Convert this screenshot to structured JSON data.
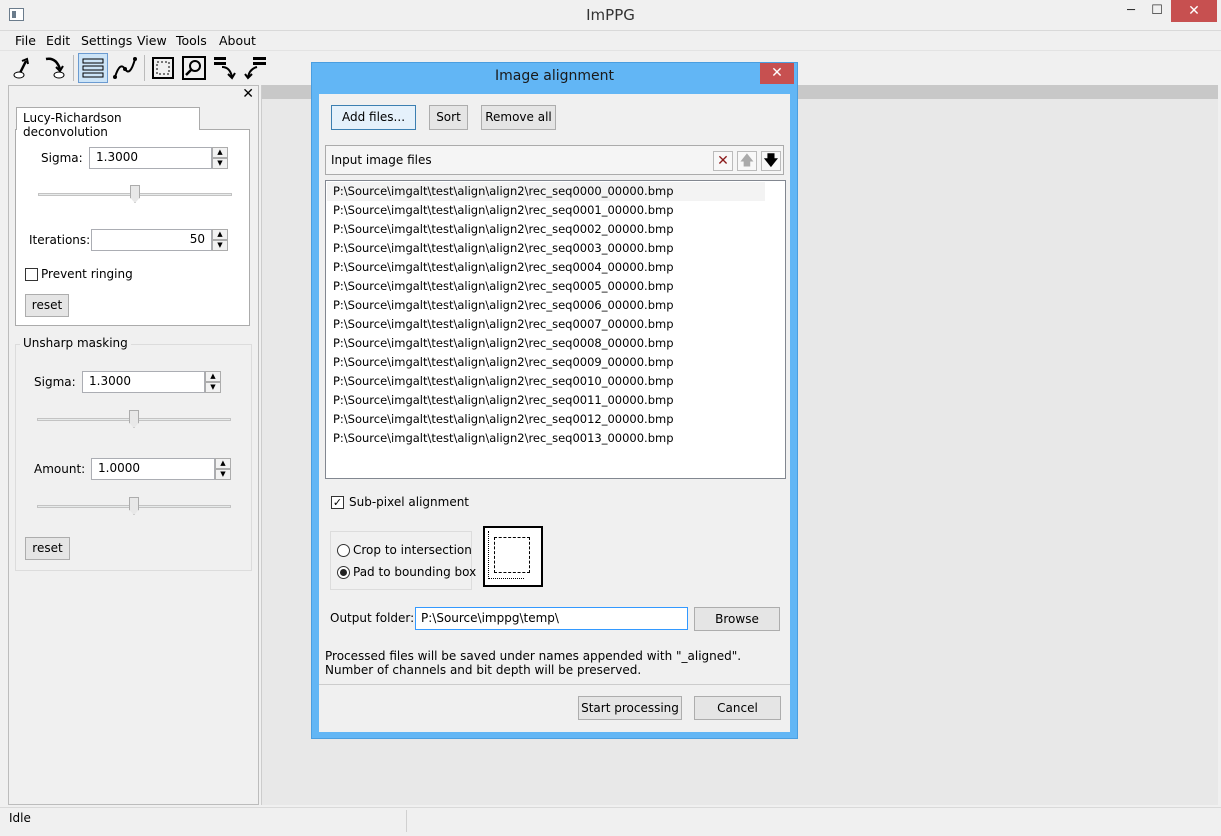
{
  "window": {
    "title": "ImPPG",
    "minimize": "─",
    "maximize": "☐",
    "close": "✕"
  },
  "menu": [
    "File",
    "Edit",
    "Settings",
    "View",
    "Tools",
    "About"
  ],
  "left_panel": {
    "close": "✕",
    "lr_tab": "Lucy-Richardson deconvolution",
    "lr": {
      "sigma_label": "Sigma:",
      "sigma_value": "1.3000",
      "iterations_label": "Iterations:",
      "iterations_value": "50",
      "prevent_ringing_label": "Prevent ringing",
      "reset_label": "reset"
    },
    "unsharp": {
      "title": "Unsharp masking",
      "sigma_label": "Sigma:",
      "sigma_value": "1.3000",
      "amount_label": "Amount:",
      "amount_value": "1.0000",
      "reset_label": "reset"
    }
  },
  "status": {
    "text": "Idle"
  },
  "dialog": {
    "title": "Image alignment",
    "close": "✕",
    "add_files": "Add files...",
    "sort": "Sort",
    "remove_all": "Remove all",
    "list_header": "Input image files",
    "files": [
      "P:\\Source\\imgalt\\test\\align\\align2\\rec_seq0000_00000.bmp",
      "P:\\Source\\imgalt\\test\\align\\align2\\rec_seq0001_00000.bmp",
      "P:\\Source\\imgalt\\test\\align\\align2\\rec_seq0002_00000.bmp",
      "P:\\Source\\imgalt\\test\\align\\align2\\rec_seq0003_00000.bmp",
      "P:\\Source\\imgalt\\test\\align\\align2\\rec_seq0004_00000.bmp",
      "P:\\Source\\imgalt\\test\\align\\align2\\rec_seq0005_00000.bmp",
      "P:\\Source\\imgalt\\test\\align\\align2\\rec_seq0006_00000.bmp",
      "P:\\Source\\imgalt\\test\\align\\align2\\rec_seq0007_00000.bmp",
      "P:\\Source\\imgalt\\test\\align\\align2\\rec_seq0008_00000.bmp",
      "P:\\Source\\imgalt\\test\\align\\align2\\rec_seq0009_00000.bmp",
      "P:\\Source\\imgalt\\test\\align\\align2\\rec_seq0010_00000.bmp",
      "P:\\Source\\imgalt\\test\\align\\align2\\rec_seq0011_00000.bmp",
      "P:\\Source\\imgalt\\test\\align\\align2\\rec_seq0012_00000.bmp",
      "P:\\Source\\imgalt\\test\\align\\align2\\rec_seq0013_00000.bmp"
    ],
    "subpixel_label": "Sub-pixel alignment",
    "crop_label": "Crop to intersection",
    "pad_label": "Pad to bounding box",
    "output_label": "Output folder:",
    "output_value": "P:\\Source\\imppg\\temp\\",
    "browse": "Browse",
    "info_line1": "Processed files will be saved under names appended with \"_aligned\".",
    "info_line2": "Number of channels and bit depth will be preserved.",
    "start": "Start processing",
    "cancel": "Cancel"
  }
}
